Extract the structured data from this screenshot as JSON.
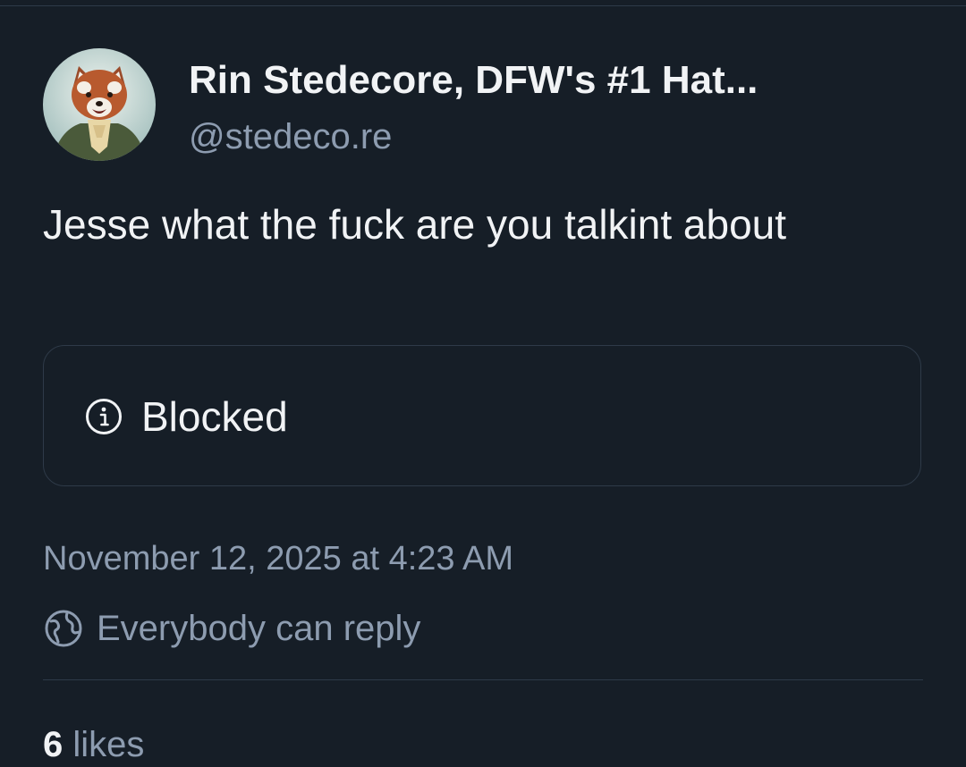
{
  "author": {
    "display_name": "Rin Stedecore, DFW's #1 Hat...",
    "handle": "@stedeco.re"
  },
  "post": {
    "text": "Jesse what the fuck are you talkint about",
    "embed": {
      "icon": "info-icon",
      "label": "Blocked"
    },
    "timestamp": "November 12, 2025 at 4:23 AM",
    "reply_setting": {
      "icon": "globe-icon",
      "label": "Everybody can reply"
    },
    "stats": {
      "likes_count": "6",
      "likes_label": "likes"
    }
  },
  "colors": {
    "background": "#161e27",
    "text_primary": "#f1f3f5",
    "text_secondary": "#8d9cb0",
    "border": "#2e3a48"
  }
}
